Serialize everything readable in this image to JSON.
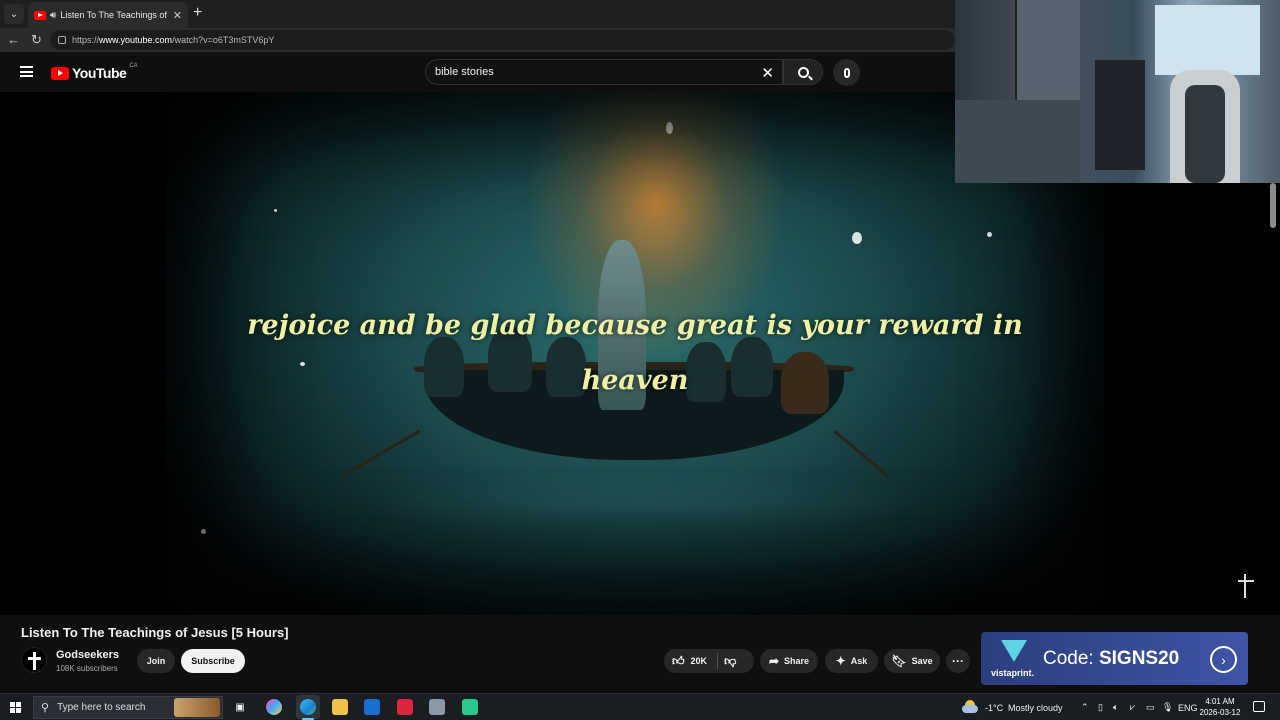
{
  "browser": {
    "tab_title": "Listen To The Teachings of Jes",
    "url_scheme": "https://",
    "url_host": "www.youtube.com",
    "url_path": "/watch?v=o6T3mSTV6pY"
  },
  "masthead": {
    "logo_text": "YouTube",
    "region": "CA",
    "search_value": "bible stories"
  },
  "video": {
    "overlay_line1": "rejoice and be glad because great is your reward in",
    "overlay_line2": "heaven"
  },
  "info": {
    "title": "Listen To The Teachings of Jesus [5 Hours]",
    "channel_name": "Godseekers",
    "subscribers": "108K subscribers",
    "join_label": "Join",
    "subscribe_label": "Subscribe",
    "like_count": "20K",
    "share_label": "Share",
    "ask_label": "Ask",
    "save_label": "Save",
    "more_label": "···"
  },
  "ad": {
    "brand": "vistaprint.",
    "code_prefix": "Code: ",
    "code_value": "SIGNS20"
  },
  "taskbar": {
    "search_placeholder": "Type here to search",
    "temperature": "-1°C",
    "weather": "Mostly cloudy",
    "language": "ENG",
    "time": "4:01 AM",
    "date": "2026-03-12"
  }
}
